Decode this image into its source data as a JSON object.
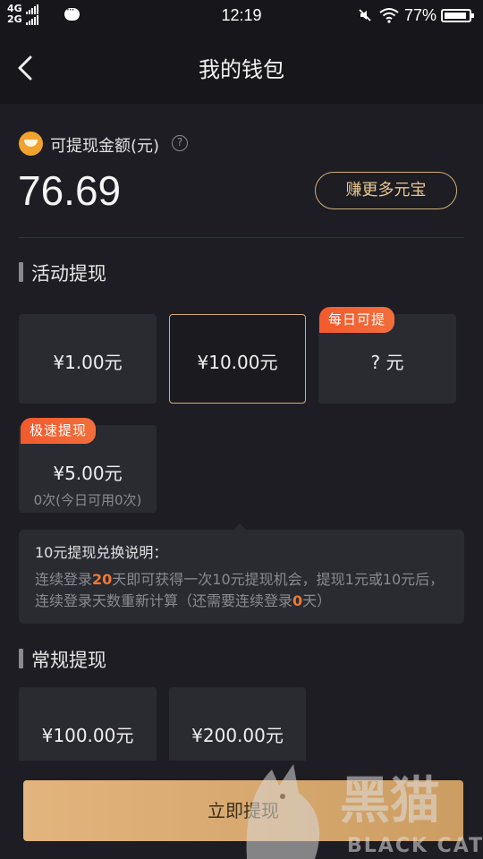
{
  "status_bar": {
    "network_top": "4G",
    "network_bottom": "2G",
    "time": "12:19",
    "battery": "77%"
  },
  "header": {
    "title": "我的钱包"
  },
  "balance": {
    "label": "可提现金额(元)",
    "help": "?",
    "amount": "76.69",
    "earn_button": "赚更多元宝"
  },
  "activity": {
    "title": "活动提现",
    "options": [
      {
        "amount": "¥1.00元",
        "selected": false
      },
      {
        "amount": "¥10.00元",
        "selected": true
      },
      {
        "amount": "? 元",
        "tag": "每日可提"
      },
      {
        "amount": "¥5.00元",
        "tag": "极速提现",
        "note": "0次(今日可用0次)"
      }
    ]
  },
  "explanation": {
    "title": "10元提现兑换说明：",
    "part1": "连续登录",
    "days_required": "20",
    "part2": "天即可获得一次10元提现机会，提现1元或10元后，连续登录天数重新计算（还需要连续登录",
    "days_remaining": "0",
    "part3": "天）"
  },
  "regular": {
    "title": "常规提现",
    "options": [
      {
        "amount": "¥100.00元"
      },
      {
        "amount": "¥200.00元"
      }
    ]
  },
  "footer": {
    "withdraw_button": "立即提现"
  },
  "watermark": {
    "text_cn": "黑猫",
    "text_en": "BLACK CAT"
  },
  "colors": {
    "background": "#1d1d23",
    "card": "#2a2a31",
    "accent_gold": "#d4ae78",
    "tag_orange": "#f25a2c",
    "highlight": "#f07830"
  }
}
